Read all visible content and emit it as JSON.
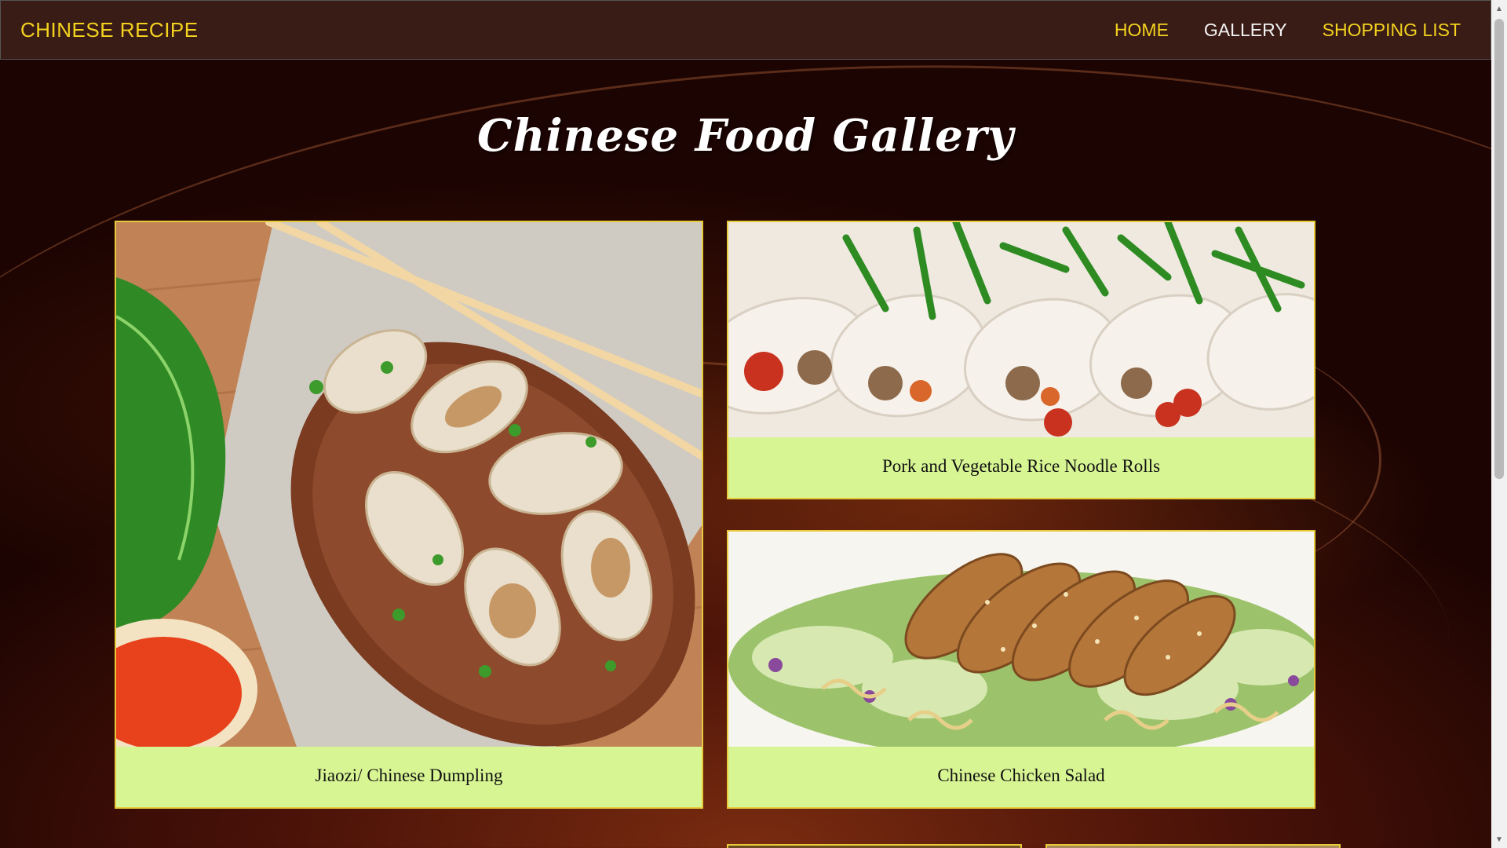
{
  "navbar": {
    "brand": "CHINESE RECIPE",
    "links": [
      {
        "label": "HOME",
        "active": false
      },
      {
        "label": "GALLERY",
        "active": true
      },
      {
        "label": "SHOPPING LIST",
        "active": false
      }
    ]
  },
  "page": {
    "title": "Chinese Food Gallery"
  },
  "gallery": {
    "items": [
      {
        "caption": "Jiaozi/ Chinese Dumpling",
        "image": "dumplings-photo"
      },
      {
        "caption": "Pork and Vegetable Rice Noodle Rolls",
        "image": "rice-noodle-rolls-photo"
      },
      {
        "caption": "Chinese Chicken Salad",
        "image": "chicken-salad-photo"
      }
    ]
  },
  "colors": {
    "nav_link": "#f3d21f",
    "nav_link_active": "#f3f3f3",
    "navbar_bg": "#3a1c16",
    "caption_bg": "#d8f594",
    "card_border": "#e7c93a"
  }
}
